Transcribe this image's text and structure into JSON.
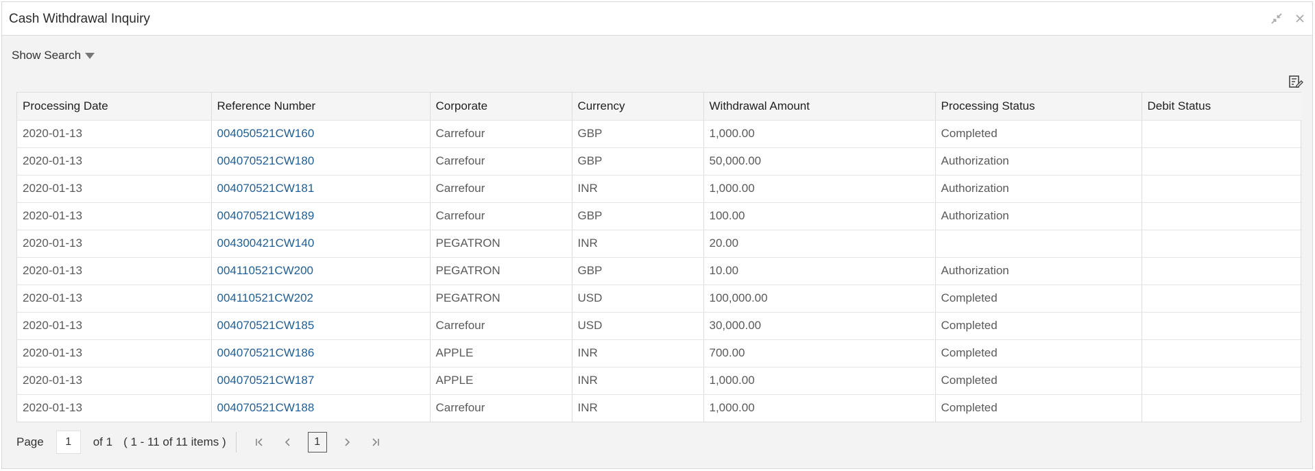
{
  "window": {
    "title": "Cash Withdrawal Inquiry"
  },
  "toolbar": {
    "show_search_label": "Show Search"
  },
  "table": {
    "headers": [
      "Processing Date",
      "Reference Number",
      "Corporate",
      "Currency",
      "Withdrawal Amount",
      "Processing Status",
      "Debit Status"
    ],
    "rows": [
      [
        "2020-01-13",
        "004050521CW160",
        "Carrefour",
        "GBP",
        "1,000.00",
        "Completed",
        ""
      ],
      [
        "2020-01-13",
        "004070521CW180",
        "Carrefour",
        "GBP",
        "50,000.00",
        "Authorization",
        ""
      ],
      [
        "2020-01-13",
        "004070521CW181",
        "Carrefour",
        "INR",
        "1,000.00",
        "Authorization",
        ""
      ],
      [
        "2020-01-13",
        "004070521CW189",
        "Carrefour",
        "GBP",
        "100.00",
        "Authorization",
        ""
      ],
      [
        "2020-01-13",
        "004300421CW140",
        "PEGATRON",
        "INR",
        "20.00",
        "",
        ""
      ],
      [
        "2020-01-13",
        "004110521CW200",
        "PEGATRON",
        "GBP",
        "10.00",
        "Authorization",
        ""
      ],
      [
        "2020-01-13",
        "004110521CW202",
        "PEGATRON",
        "USD",
        "100,000.00",
        "Completed",
        ""
      ],
      [
        "2020-01-13",
        "004070521CW185",
        "Carrefour",
        "USD",
        "30,000.00",
        "Completed",
        ""
      ],
      [
        "2020-01-13",
        "004070521CW186",
        "APPLE",
        "INR",
        "700.00",
        "Completed",
        ""
      ],
      [
        "2020-01-13",
        "004070521CW187",
        "APPLE",
        "INR",
        "1,000.00",
        "Completed",
        ""
      ],
      [
        "2020-01-13",
        "004070521CW188",
        "Carrefour",
        "INR",
        "1,000.00",
        "Completed",
        ""
      ]
    ]
  },
  "pager": {
    "page_label": "Page",
    "current_page": "1",
    "of_label": "of 1",
    "items_label": "( 1 - 11 of 11 items )",
    "page_button": "1"
  }
}
